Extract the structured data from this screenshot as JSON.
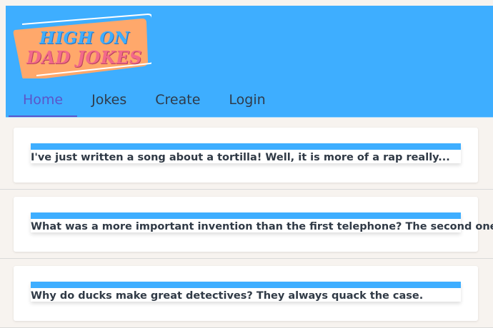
{
  "header": {
    "logo": {
      "line1": "HIGH ON",
      "line2": "DAD JOKES"
    },
    "nav": [
      {
        "label": "Home",
        "active": true
      },
      {
        "label": "Jokes",
        "active": false
      },
      {
        "label": "Create",
        "active": false
      },
      {
        "label": "Login",
        "active": false
      }
    ]
  },
  "jokes": [
    {
      "text": "I've just written a song about a tortilla! Well, it is more of a rap really..."
    },
    {
      "text": "What was a more important invention than the first telephone? The second one."
    },
    {
      "text": "Why do ducks make great detectives? They always quack the case."
    }
  ],
  "colors": {
    "header_bg": "#3eaeff",
    "active_tab": "#5b55c9",
    "logo_blue": "#3eaeff",
    "logo_pink": "#f2698a",
    "logo_badge": "#ffa86b",
    "page_bg": "#f7f3ef",
    "card_bar": "#3eaeff"
  }
}
